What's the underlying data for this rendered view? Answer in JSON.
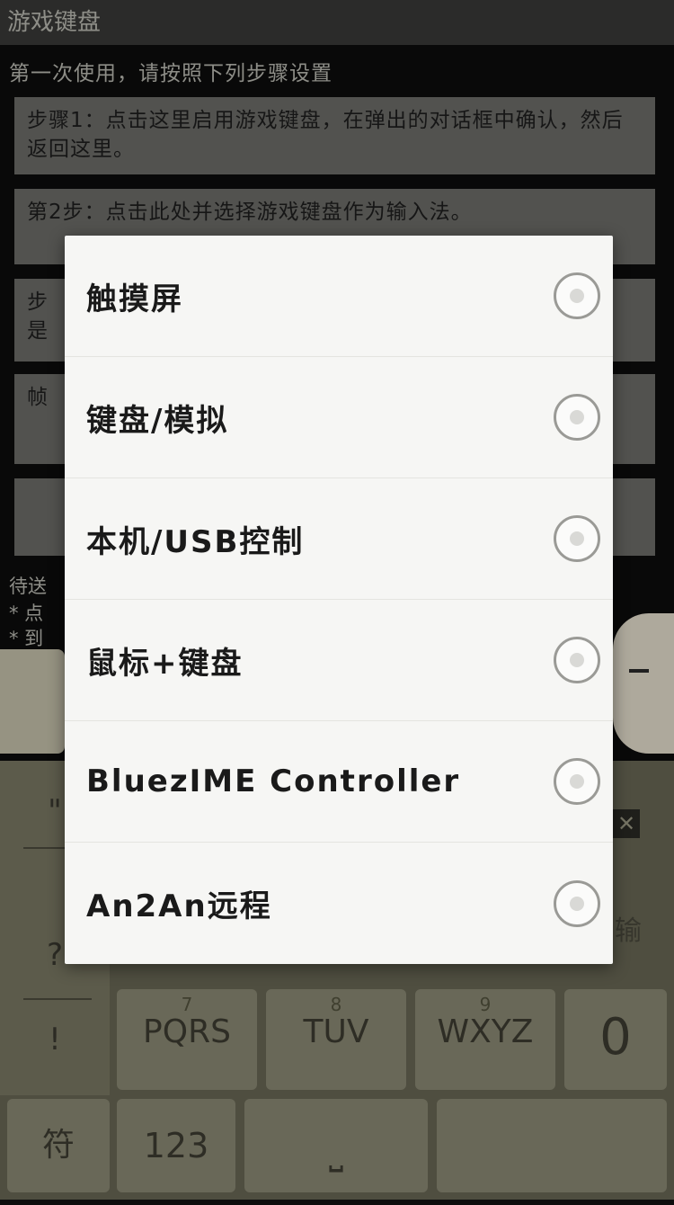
{
  "app": {
    "title": "游戏键盘"
  },
  "background": {
    "intro": "第一次使用，请按照下列步骤设置",
    "step1": "步骤1：点击这里启用游戏键盘，在弹出的对话框中确认，然后返回这里。",
    "step2": "第2步：点击此处并选择游戏键盘作为输入法。",
    "step3_fragment": "步",
    "step3_fragment2": "是",
    "step4_fragment": "帧",
    "hint1": "待送",
    "hint2": "* 点",
    "hint3": "* 到"
  },
  "keyboard": {
    "keys": [
      {
        "num": "7",
        "letters": "PQRS"
      },
      {
        "num": "8",
        "letters": "TUV"
      },
      {
        "num": "9",
        "letters": "WXYZ"
      }
    ],
    "zero": "0",
    "symbol_key": "符",
    "num_key": "123",
    "space_key": "⎵",
    "side_symbols": [
      "\"",
      "?",
      "!"
    ],
    "enter_partial": "输",
    "back_glyph": "✕"
  },
  "dialog": {
    "options": [
      {
        "label": "触摸屏",
        "selected": false
      },
      {
        "label": "键盘/模拟",
        "selected": false
      },
      {
        "label": "本机/USB控制",
        "selected": false
      },
      {
        "label": "鼠标+键盘",
        "selected": false
      },
      {
        "label": "BluezIME Controller",
        "selected": false
      },
      {
        "label": "An2An远程",
        "selected": false
      }
    ]
  },
  "colors": {
    "dialog_bg": "#f6f6f4",
    "radio_border": "#9a9a96",
    "keyboard_bg": "#6a6956"
  }
}
